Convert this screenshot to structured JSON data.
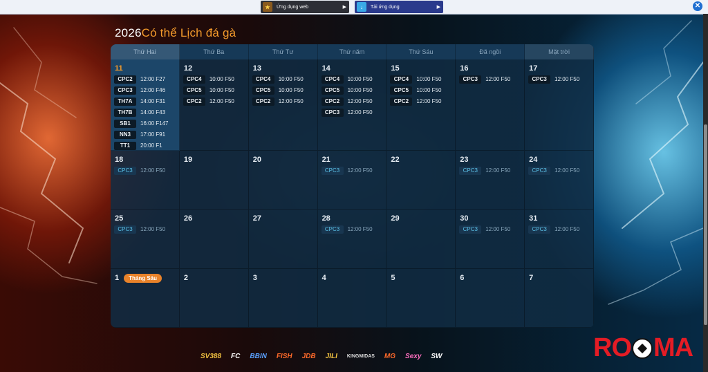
{
  "topbar": {
    "web_button": {
      "label": "Ứng dụng web",
      "icon": "web-app-icon"
    },
    "app_button": {
      "label": "Tải ứng dụng",
      "icon": "download-app-icon"
    },
    "close_icon": "close-icon"
  },
  "page_title": {
    "year": "2026",
    "text": "Có thể Lịch đá gà"
  },
  "calendar": {
    "weekdays": [
      "Thứ Hai",
      "Thứ Ba",
      "Thứ Tư",
      "Thứ năm",
      "Thứ Sáu",
      "Đã ngồi",
      "Mặt trời"
    ],
    "weeks": [
      [
        {
          "day": "11",
          "today": true,
          "events": [
            {
              "code": "CPC2",
              "time": "12:00 F27"
            },
            {
              "code": "CPC3",
              "time": "12:00 F46"
            },
            {
              "code": "TH7A",
              "time": "14:00 F31"
            },
            {
              "code": "TH7B",
              "time": "14:00 F43"
            },
            {
              "code": "SB1",
              "time": "16:00 F147"
            },
            {
              "code": "NN3",
              "time": "17:00 F91"
            },
            {
              "code": "TT1",
              "time": "20:00 F1"
            }
          ]
        },
        {
          "day": "12",
          "events": [
            {
              "code": "CPC4",
              "time": "10:00 F50"
            },
            {
              "code": "CPC5",
              "time": "10:00 F50"
            },
            {
              "code": "CPC2",
              "time": "12:00 F50"
            }
          ]
        },
        {
          "day": "13",
          "events": [
            {
              "code": "CPC4",
              "time": "10:00 F50"
            },
            {
              "code": "CPC5",
              "time": "10:00 F50"
            },
            {
              "code": "CPC2",
              "time": "12:00 F50"
            }
          ]
        },
        {
          "day": "14",
          "events": [
            {
              "code": "CPC4",
              "time": "10:00 F50"
            },
            {
              "code": "CPC5",
              "time": "10:00 F50"
            },
            {
              "code": "CPC2",
              "time": "12:00 F50"
            },
            {
              "code": "CPC3",
              "time": "12:00 F50"
            }
          ]
        },
        {
          "day": "15",
          "events": [
            {
              "code": "CPC4",
              "time": "10:00 F50"
            },
            {
              "code": "CPC5",
              "time": "10:00 F50"
            },
            {
              "code": "CPC2",
              "time": "12:00 F50"
            }
          ]
        },
        {
          "day": "16",
          "events": [
            {
              "code": "CPC3",
              "time": "12:00 F50"
            }
          ]
        },
        {
          "day": "17",
          "events": [
            {
              "code": "CPC3",
              "time": "12:00 F50"
            }
          ]
        }
      ],
      [
        {
          "day": "18",
          "muted": true,
          "events": [
            {
              "code": "CPC3",
              "time": "12:00 F50"
            }
          ]
        },
        {
          "day": "19",
          "events": []
        },
        {
          "day": "20",
          "events": []
        },
        {
          "day": "21",
          "muted": true,
          "events": [
            {
              "code": "CPC3",
              "time": "12:00 F50"
            }
          ]
        },
        {
          "day": "22",
          "events": []
        },
        {
          "day": "23",
          "muted": true,
          "events": [
            {
              "code": "CPC3",
              "time": "12:00 F50"
            }
          ]
        },
        {
          "day": "24",
          "muted": true,
          "events": [
            {
              "code": "CPC3",
              "time": "12:00 F50"
            }
          ]
        }
      ],
      [
        {
          "day": "25",
          "muted": true,
          "events": [
            {
              "code": "CPC3",
              "time": "12:00 F50"
            }
          ]
        },
        {
          "day": "26",
          "events": []
        },
        {
          "day": "27",
          "events": []
        },
        {
          "day": "28",
          "muted": true,
          "events": [
            {
              "code": "CPC3",
              "time": "12:00 F50"
            }
          ]
        },
        {
          "day": "29",
          "events": []
        },
        {
          "day": "30",
          "muted": true,
          "events": [
            {
              "code": "CPC3",
              "time": "12:00 F50"
            }
          ]
        },
        {
          "day": "31",
          "muted": true,
          "events": [
            {
              "code": "CPC3",
              "time": "12:00 F50"
            }
          ]
        }
      ],
      [
        {
          "day": "1",
          "badge": "Tháng Sáu",
          "events": []
        },
        {
          "day": "2",
          "events": []
        },
        {
          "day": "3",
          "events": []
        },
        {
          "day": "4",
          "events": []
        },
        {
          "day": "5",
          "events": []
        },
        {
          "day": "6",
          "events": []
        },
        {
          "day": "7",
          "events": []
        }
      ]
    ]
  },
  "footer": {
    "partner_logos": [
      "SV388",
      "FC",
      "BBIN",
      "FISH",
      "JDB",
      "JILI",
      "KINGMIDAS",
      "MG",
      "Sexy",
      "SW"
    ],
    "brand": "ROMA"
  },
  "colors": {
    "accent_orange": "#f39a2b",
    "calendar_bg": "#102c44",
    "brand_red": "#e41c25",
    "top_app_button": "#2a3a8c"
  }
}
